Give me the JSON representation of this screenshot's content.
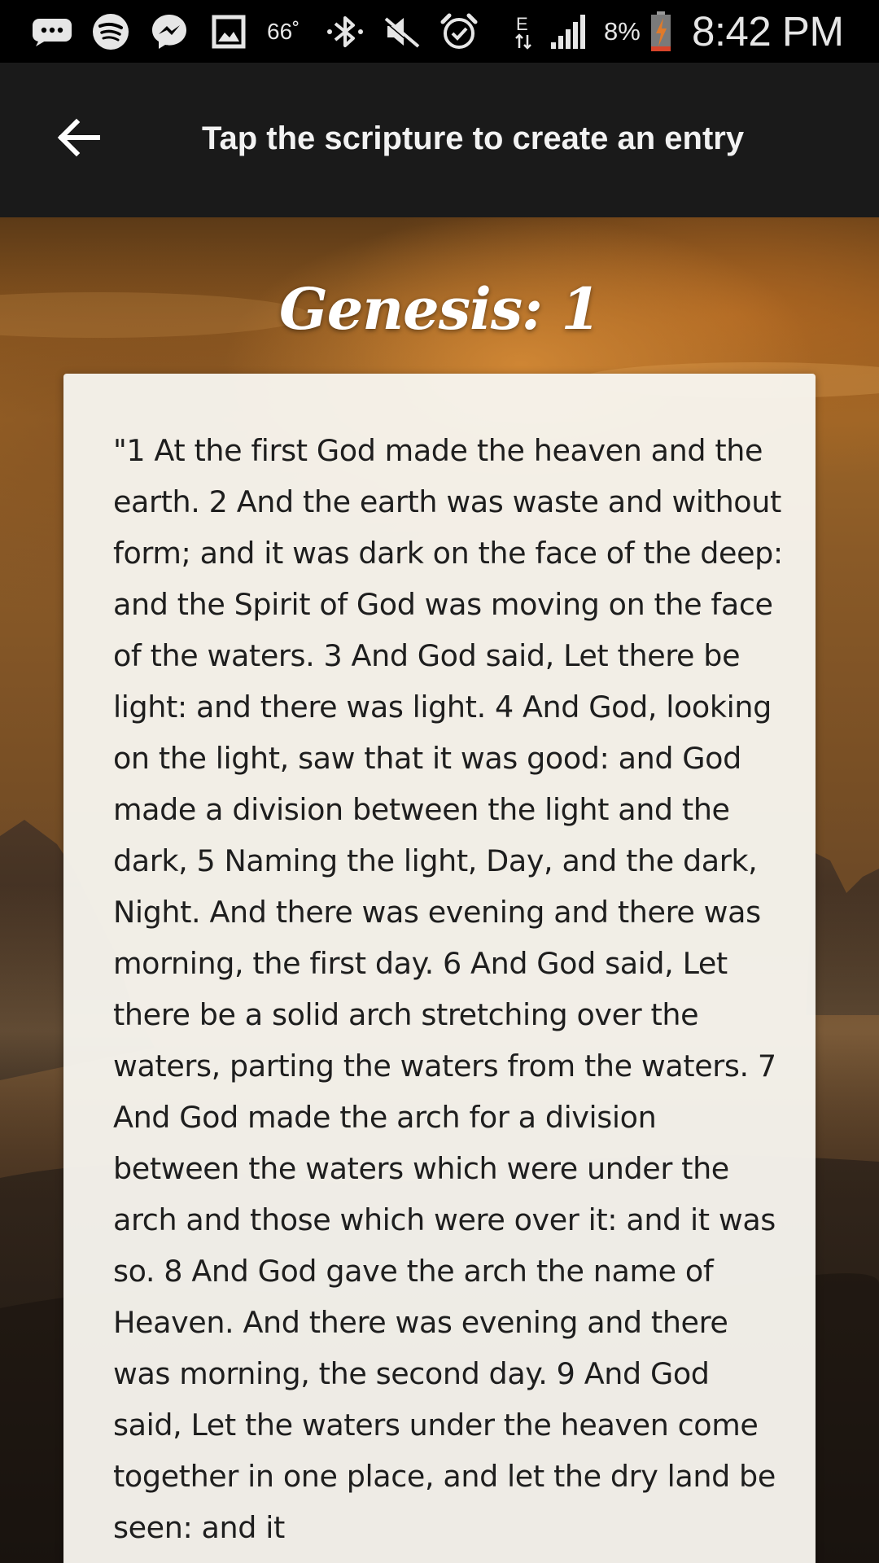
{
  "status_bar": {
    "temperature": "66˚",
    "battery_percent": "8%",
    "time": "8:42 PM",
    "icons": [
      "messages-icon",
      "spotify-icon",
      "messenger-icon",
      "gallery-icon",
      "bluetooth-icon",
      "mute-icon",
      "alarm-icon",
      "data-e-icon",
      "signal-icon",
      "battery-charging-icon"
    ]
  },
  "app_bar": {
    "back_icon": "arrow-back-icon",
    "title": "Tap the scripture to create an entry"
  },
  "chapter": {
    "title": "Genesis: 1"
  },
  "scripture": {
    "text": "\"1 At the first God made the heaven and the earth. 2 And the earth was waste and without form; and it was dark on the face of the deep: and the Spirit of God was moving on the face of the waters. 3 And God said, Let there be light: and there was light. 4 And God, looking on the light, saw that it was good: and God made a division between the light and the dark, 5 Naming the light, Day, and the dark, Night. And there was evening and there was morning, the first day. 6 And God said, Let there be a solid arch stretching over the waters, parting the waters from the waters. 7 And God made the arch for a division between the waters which were under the arch and those which were over it: and it was so. 8 And God gave the arch the name of Heaven. And there was evening and there was morning, the second day. 9 And God said, Let the waters under the heaven come together in one place, and let the dry land be seen: and it"
  },
  "colors": {
    "status_bar_bg": "#000000",
    "app_bar_bg": "#1a1a1a",
    "app_bar_text": "#f2f2f2",
    "card_bg": "#f7f5ee",
    "card_text": "#1e1e1e",
    "sky_accent": "#d78c37"
  }
}
